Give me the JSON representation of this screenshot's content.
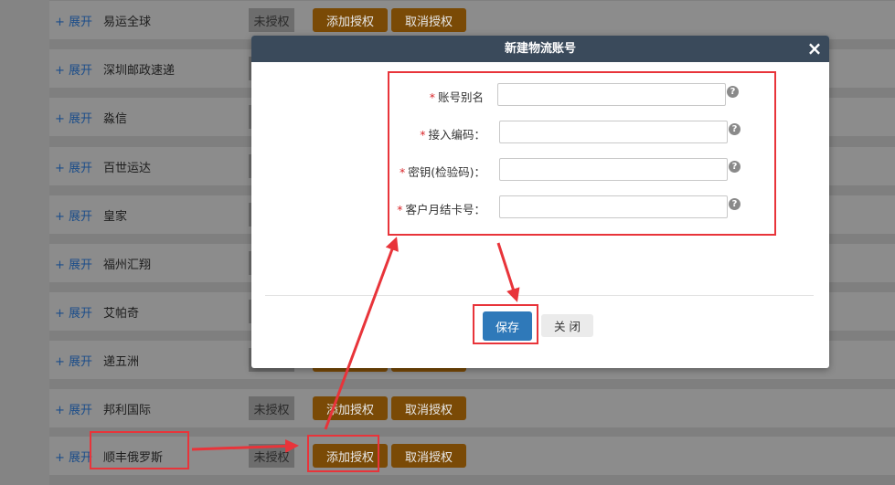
{
  "list": {
    "rows": [
      {
        "expand": "+ 展开",
        "name": "易运全球",
        "status": "未授权",
        "add_label": "添加授权",
        "cancel_label": "取消授权"
      },
      {
        "expand": "+ 展开",
        "name": "深圳邮政速递"
      },
      {
        "expand": "+ 展开",
        "name": "淼信"
      },
      {
        "expand": "+ 展开",
        "name": "百世运达"
      },
      {
        "expand": "+ 展开",
        "name": "皇家"
      },
      {
        "expand": "+ 展开",
        "name": "福州汇翔"
      },
      {
        "expand": "+ 展开",
        "name": "艾帕奇"
      },
      {
        "expand": "+ 展开",
        "name": "递五洲"
      },
      {
        "expand": "+ 展开",
        "name": "邦利国际",
        "status": "未授权",
        "add_label": "添加授权",
        "cancel_label": "取消授权"
      },
      {
        "expand": "+ 展开",
        "name": "顺丰俄罗斯",
        "status": "未授权",
        "add_label": "添加授权",
        "cancel_label": "取消授权"
      }
    ]
  },
  "modal": {
    "title": "新建物流账号",
    "close_icon": "×",
    "fields": [
      {
        "required_mark": "*",
        "label": "账号别名",
        "value": "",
        "help": "?"
      },
      {
        "required_mark": "*",
        "label": "接入编码：",
        "value": "",
        "help": "?"
      },
      {
        "required_mark": "*",
        "label": "密钥(检验码)：",
        "value": "",
        "help": "?"
      },
      {
        "required_mark": "*",
        "label": "客户月结卡号：",
        "value": "",
        "help": "?"
      }
    ],
    "save_label": "保存",
    "close_label": "关 闭"
  },
  "colors": {
    "annotation": "#e8343a",
    "header_bg": "#3a4a5b",
    "save_bg": "#2f79b9",
    "action_btn": "#c97a0b"
  }
}
